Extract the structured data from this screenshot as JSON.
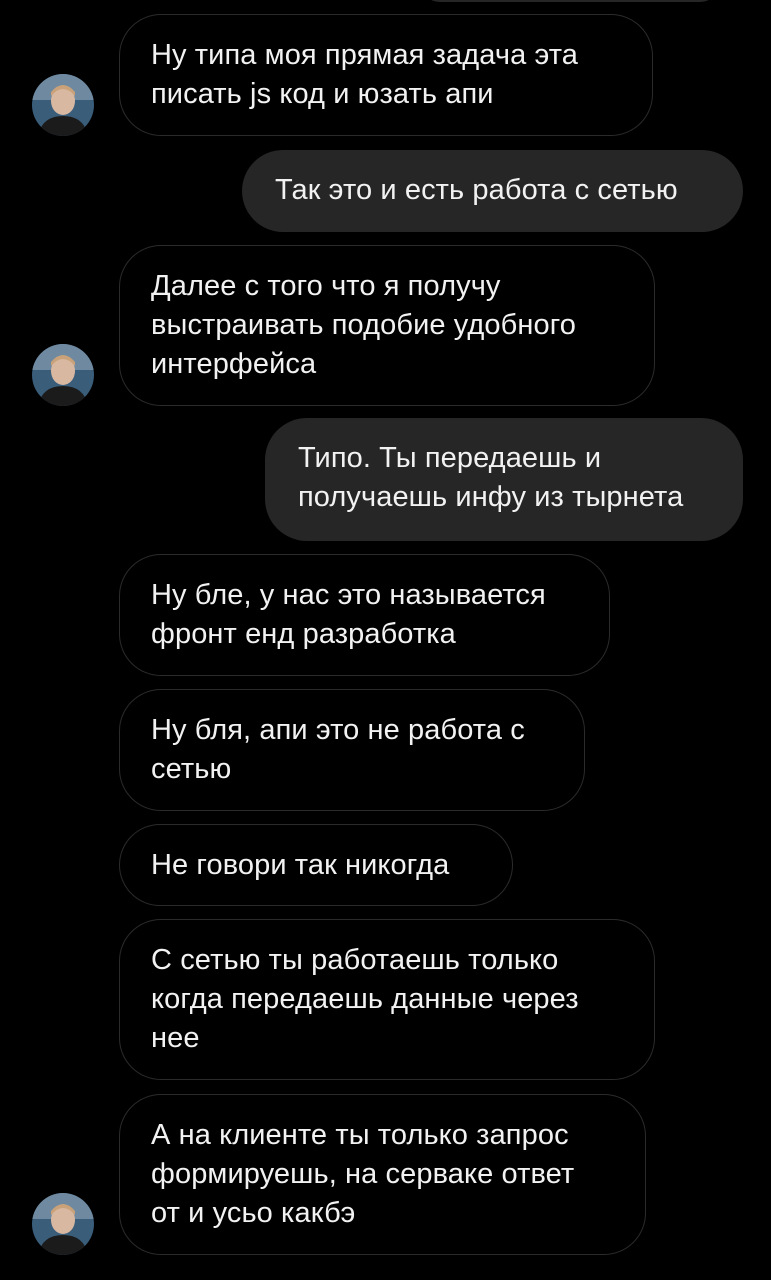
{
  "chat": {
    "messages": [
      {
        "side": "in",
        "text": "Ну типа моя прямая задача эта\nписать js код и юзать апи",
        "avatar": true
      },
      {
        "side": "out",
        "text": "Так это и есть работа с сетью"
      },
      {
        "side": "in",
        "text": "Далее с того что я получу\nвыстраивать подобие удобного\nинтерфейса",
        "avatar": true
      },
      {
        "side": "out",
        "text": "Типо. Ты передаешь и\nполучаешь инфу из тырнета"
      },
      {
        "side": "in",
        "text": "Ну бле, у нас это называется\nфронт енд разработка"
      },
      {
        "side": "in",
        "text": "Ну бля, апи это не работа с\nсетью"
      },
      {
        "side": "in",
        "text": "Не говори так никогда"
      },
      {
        "side": "in",
        "text": "С сетью ты работаешь только\nкогда передаешь данные через\nнее"
      },
      {
        "side": "in",
        "text": "А на клиенте ты только запрос\nформируешь, на серваке ответ\nот и усьо какбэ",
        "avatar": true
      }
    ]
  },
  "colors": {
    "background": "#000000",
    "incoming_border": "#2b2b2b",
    "outgoing_fill": "#262626",
    "text": "#f2f2f2"
  },
  "icons": {
    "avatar": "user-avatar-icon"
  }
}
